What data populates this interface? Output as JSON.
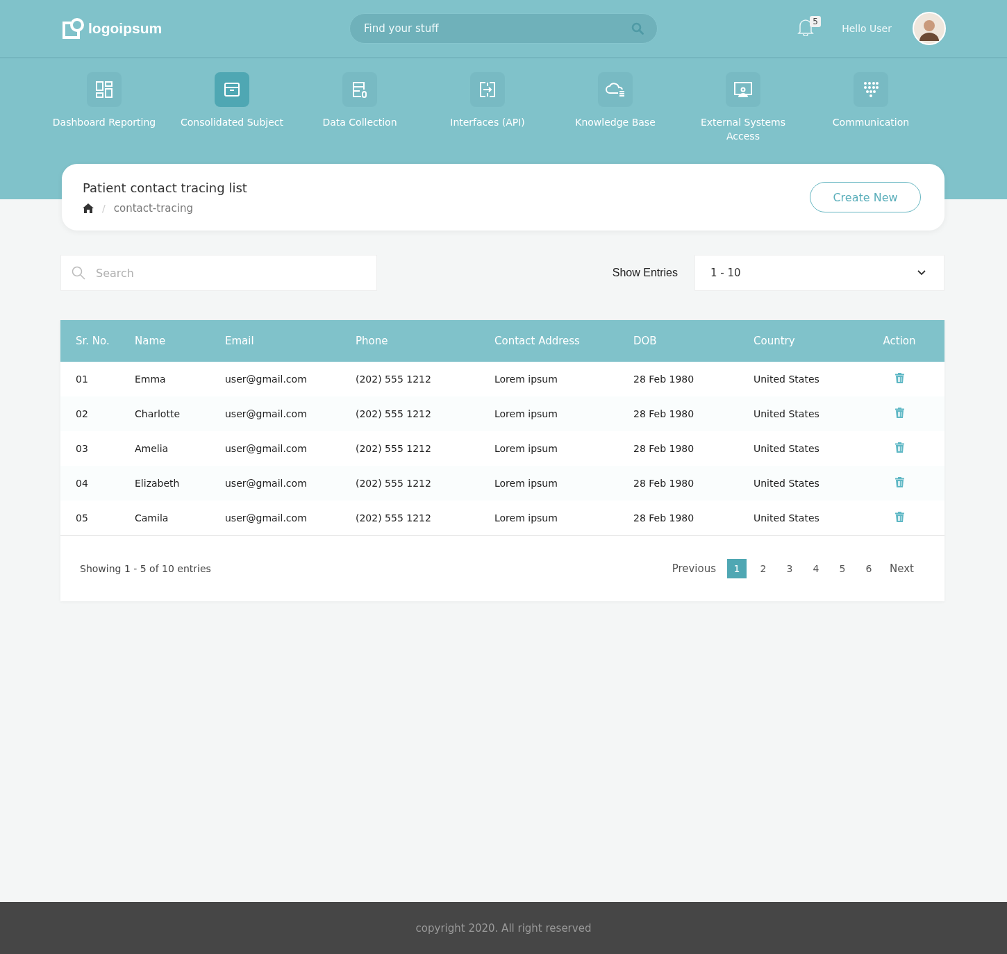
{
  "header": {
    "logo": "logoipsum",
    "search": {
      "placeholder": "Find your stuff"
    },
    "notifications": "5",
    "greeting": "Hello User"
  },
  "nav": [
    {
      "label": "Dashboard Reporting",
      "selected": false
    },
    {
      "label": "Consolidated Subject",
      "selected": true
    },
    {
      "label": "Data Collection",
      "selected": false
    },
    {
      "label": "Interfaces (API)",
      "selected": false
    },
    {
      "label": "Knowledge Base",
      "selected": false
    },
    {
      "label": "External Systems Access",
      "selected": false
    },
    {
      "label": "Communication",
      "selected": false
    }
  ],
  "page": {
    "title": "Patient contact tracing list",
    "breadcrumb_separator": "/",
    "breadcrumb": "contact-tracing",
    "create_button": "Create New"
  },
  "filters": {
    "search": {
      "placeholder": "Search"
    },
    "show_entries_label": "Show Entries",
    "entries_value": "1 - 10"
  },
  "table": {
    "columns": [
      "Sr. No.",
      "Name",
      "Email",
      "Phone",
      "Contact Address",
      "DOB",
      "Country",
      "Action"
    ],
    "rows": [
      [
        "01",
        "Emma",
        "user@gmail.com",
        "(202) 555 1212",
        "Lorem ipsum",
        "28 Feb 1980",
        "United States"
      ],
      [
        "02",
        "Charlotte",
        "user@gmail.com",
        "(202) 555 1212",
        "Lorem ipsum",
        "28 Feb 1980",
        "United States"
      ],
      [
        "03",
        "Amelia",
        "user@gmail.com",
        "(202) 555 1212",
        "Lorem ipsum",
        "28 Feb 1980",
        "United States"
      ],
      [
        "04",
        "Elizabeth",
        "user@gmail.com",
        "(202) 555 1212",
        "Lorem ipsum",
        "28 Feb 1980",
        "United States"
      ],
      [
        "05",
        "Camila",
        "user@gmail.com",
        "(202) 555 1212",
        "Lorem ipsum",
        "28 Feb 1980",
        "United States"
      ]
    ]
  },
  "pagination": {
    "summary": "Showing 1 - 5 of 10 entries",
    "previous": "Previous",
    "pages": [
      {
        "label": "1",
        "selected": true
      },
      {
        "label": "2",
        "selected": false
      },
      {
        "label": "3",
        "selected": false
      },
      {
        "label": "4",
        "selected": false
      },
      {
        "label": "5",
        "selected": false
      },
      {
        "label": "6",
        "selected": false
      }
    ],
    "next": "Next"
  },
  "footer": "copyright 2020. All right reserved"
}
